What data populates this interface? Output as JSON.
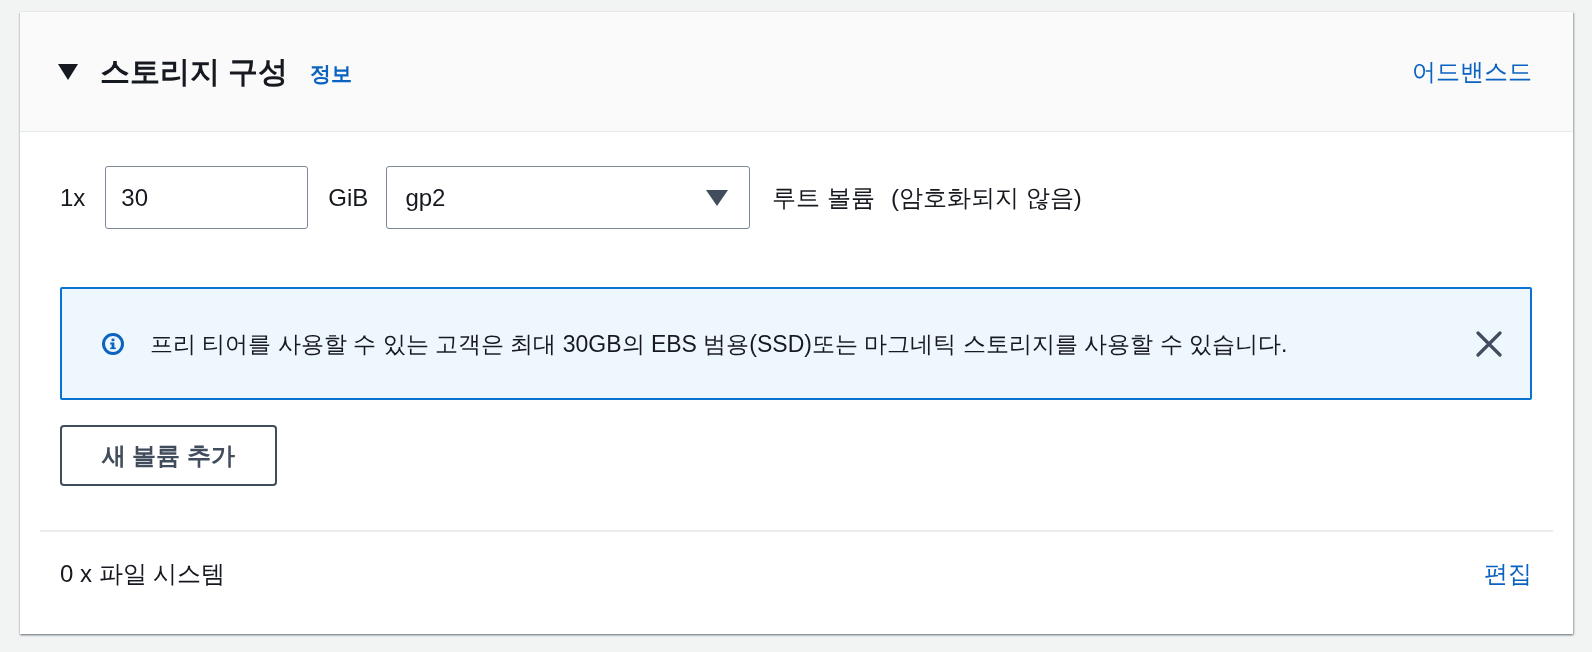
{
  "section": {
    "title": "스토리지 구성",
    "expanded": true,
    "info_link": "정보",
    "advanced_link": "어드밴스드"
  },
  "volume": {
    "count": "1x",
    "size": "30",
    "unit": "GiB",
    "volume_type": "gp2",
    "volume_label": "루트 볼륨",
    "encryption": "(암호화되지 않음)"
  },
  "info_alert": {
    "message": "프리 티어를 사용할 수 있는 고객은 최대 30GB의 EBS 범용(SSD)또는 마그네틱 스토리지를 사용할 수 있습니다."
  },
  "add_volume_button": "새 볼륨 추가",
  "file_systems": {
    "summary": "0 x 파일 시스템",
    "edit_link": "편집"
  }
}
